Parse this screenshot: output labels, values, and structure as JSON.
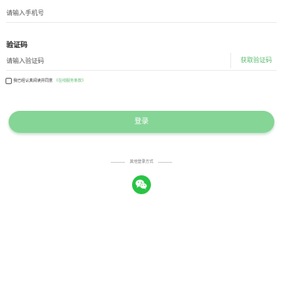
{
  "phone": {
    "placeholder": "请输入手机号"
  },
  "code": {
    "label": "验证码",
    "placeholder": "请输入验证码",
    "get_code_label": "获取验证码"
  },
  "agreement": {
    "text": "我已经认真阅读并同意",
    "link": "《在线服务条款》"
  },
  "login": {
    "button_label": "登录"
  },
  "other_login": {
    "label": "其他登录方式",
    "icon": "wechat-icon"
  },
  "colors": {
    "accent": "#5cbb6f",
    "button": "#85d596",
    "wechat": "#28c445"
  }
}
